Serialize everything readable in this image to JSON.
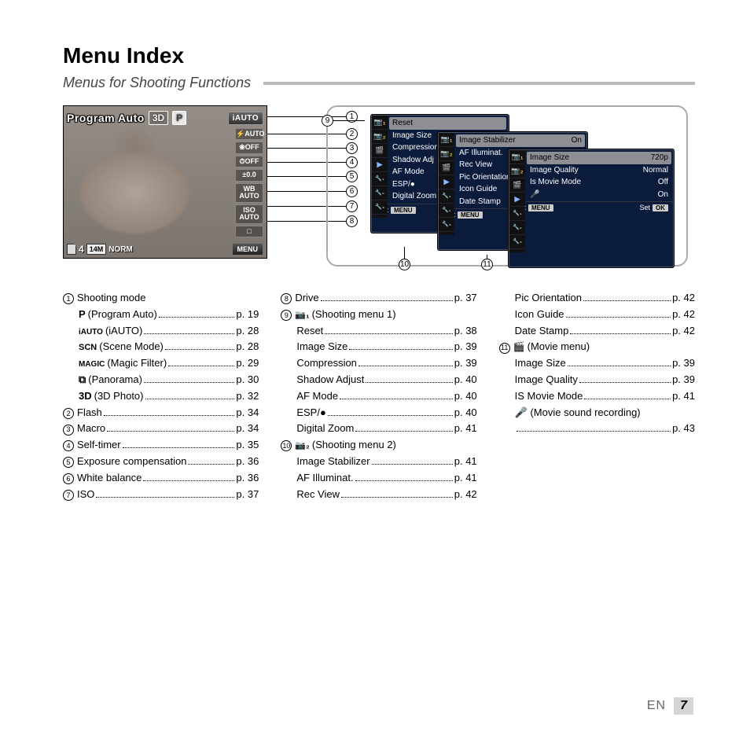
{
  "title": "Menu Index",
  "subtitle": "Menus for Shooting Functions",
  "lcd": {
    "top_label": "Program Auto",
    "badge_3d": "3D",
    "badge_p": "P",
    "iauto": "iAUTO",
    "right_pills": [
      "⚡AUTO",
      "❀OFF",
      "⏱OFF",
      "±0.0",
      "WB\nAUTO",
      "ISO\nAUTO",
      "□"
    ],
    "bottom_num": "4",
    "bottom_size": "14M",
    "bottom_norm": "NORM",
    "menu_btn": "MENU"
  },
  "callouts": [
    "1",
    "2",
    "3",
    "4",
    "5",
    "6",
    "7",
    "8",
    "9",
    "10",
    "11"
  ],
  "menu9": {
    "rows": [
      "Reset",
      "Image Size",
      "Compression",
      "Shadow Adj",
      "AF Mode",
      "ESP/●",
      "Digital Zoom"
    ],
    "exit": "Exit",
    "exit_btn": "MENU"
  },
  "menu10": {
    "rows": [
      {
        "l": "Image Stabilizer",
        "r": "On"
      },
      {
        "l": "AF Illuminat.",
        "r": ""
      },
      {
        "l": "Rec View",
        "r": ""
      },
      {
        "l": "Pic Orientation",
        "r": ""
      },
      {
        "l": "Icon Guide",
        "r": ""
      },
      {
        "l": "Date Stamp",
        "r": ""
      }
    ],
    "exit": "Exit",
    "exit_btn": "MENU"
  },
  "menu11": {
    "rows": [
      {
        "l": "Image Size",
        "r": "720p"
      },
      {
        "l": "Image Quality",
        "r": "Normal"
      },
      {
        "l": "Is Movie Mode",
        "r": "Off"
      },
      {
        "l": "🎤",
        "r": "On"
      }
    ],
    "exit": "Exit",
    "exit_btn": "MENU",
    "set": "Set",
    "set_btn": "OK"
  },
  "index_col1": {
    "i1_head": "Shooting mode",
    "i1_items": [
      {
        "icon": "P",
        "label": " (Program Auto)",
        "page": "p. 19"
      },
      {
        "icon": "iAUTO",
        "label": " (iAUTO)",
        "page": "p. 28"
      },
      {
        "icon": "SCN",
        "label": " (Scene Mode)",
        "page": "p. 28"
      },
      {
        "icon": "MAGIC",
        "label": " (Magic Filter)",
        "page": "p. 29"
      },
      {
        "icon": "⧉",
        "label": " (Panorama)",
        "page": "p. 30"
      },
      {
        "icon": "3D",
        "label": " (3D Photo)",
        "page": "p. 32"
      }
    ],
    "i2": {
      "label": "Flash",
      "page": "p. 34"
    },
    "i3": {
      "label": "Macro",
      "page": "p. 34"
    },
    "i4": {
      "label": "Self-timer",
      "page": "p. 35"
    },
    "i5": {
      "label": "Exposure compensation",
      "page": "p. 36"
    },
    "i6": {
      "label": "White balance",
      "page": "p. 36"
    },
    "i7": {
      "label": "ISO",
      "page": "p. 37"
    }
  },
  "index_col2": {
    "i8": {
      "label": "Drive",
      "page": "p. 37"
    },
    "i9_head": " (Shooting menu 1)",
    "i9_icon": "📷₁",
    "i9_items": [
      {
        "label": "Reset",
        "page": "p. 38"
      },
      {
        "label": "Image Size",
        "page": "p. 39"
      },
      {
        "label": "Compression",
        "page": "p. 39"
      },
      {
        "label": "Shadow Adjust",
        "page": "p. 40"
      },
      {
        "label": "AF Mode",
        "page": "p. 40"
      },
      {
        "label": "ESP/●",
        "page": "p. 40"
      },
      {
        "label": "Digital Zoom",
        "page": "p. 41"
      }
    ],
    "i10_head": " (Shooting menu 2)",
    "i10_icon": "📷₂",
    "i10_items": [
      {
        "label": "Image Stabilizer",
        "page": "p. 41"
      },
      {
        "label": "AF Illuminat.",
        "page": "p. 41"
      },
      {
        "label": "Rec View",
        "page": "p. 42"
      }
    ]
  },
  "index_col3": {
    "cont": [
      {
        "label": "Pic Orientation",
        "page": "p. 42"
      },
      {
        "label": "Icon Guide",
        "page": "p. 42"
      },
      {
        "label": "Date Stamp",
        "page": "p. 42"
      }
    ],
    "i11_head": " (Movie menu)",
    "i11_icon": "🎬",
    "i11_items": [
      {
        "label": "Image Size",
        "page": "p. 39"
      },
      {
        "label": "Image Quality",
        "page": "p. 39"
      },
      {
        "label": "IS Movie Mode",
        "page": "p. 41"
      },
      {
        "label": "🎤 (Movie sound recording)",
        "page": ""
      },
      {
        "label": "",
        "page": "p. 43"
      }
    ]
  },
  "footer": {
    "lang": "EN",
    "page": "7"
  }
}
